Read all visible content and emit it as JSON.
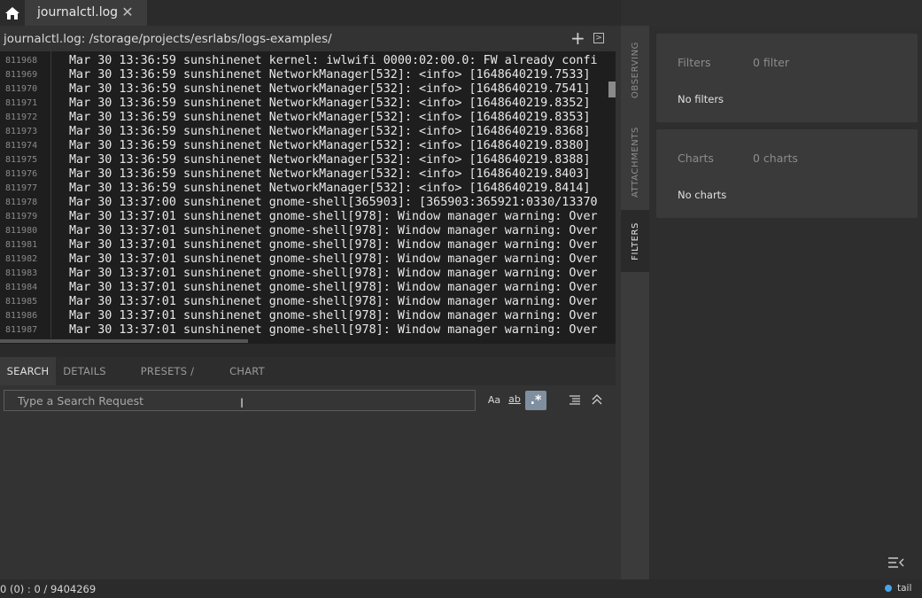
{
  "tabs": {
    "home_icon": "home-icon",
    "file_tab_label": "journalctl.log",
    "close_symbol": "✕"
  },
  "pathbar": {
    "label": "journalctl.log: /storage/projects/esrlabs/logs-examples/",
    "add_symbol": "+",
    "panel_symbol": ">"
  },
  "log": {
    "rows": [
      {
        "num": "811968",
        "text": "Mar 30 13:36:59 sunshinenet kernel: iwlwifi 0000:02:00.0: FW already confi"
      },
      {
        "num": "811969",
        "text": "Mar 30 13:36:59 sunshinenet NetworkManager[532]: <info> [1648640219.7533]"
      },
      {
        "num": "811970",
        "text": "Mar 30 13:36:59 sunshinenet NetworkManager[532]: <info> [1648640219.7541]"
      },
      {
        "num": "811971",
        "text": "Mar 30 13:36:59 sunshinenet NetworkManager[532]: <info> [1648640219.8352]"
      },
      {
        "num": "811972",
        "text": "Mar 30 13:36:59 sunshinenet NetworkManager[532]: <info> [1648640219.8353]"
      },
      {
        "num": "811973",
        "text": "Mar 30 13:36:59 sunshinenet NetworkManager[532]: <info> [1648640219.8368]"
      },
      {
        "num": "811974",
        "text": "Mar 30 13:36:59 sunshinenet NetworkManager[532]: <info> [1648640219.8380]"
      },
      {
        "num": "811975",
        "text": "Mar 30 13:36:59 sunshinenet NetworkManager[532]: <info> [1648640219.8388]"
      },
      {
        "num": "811976",
        "text": "Mar 30 13:36:59 sunshinenet NetworkManager[532]: <info> [1648640219.8403]"
      },
      {
        "num": "811977",
        "text": "Mar 30 13:36:59 sunshinenet NetworkManager[532]: <info> [1648640219.8414]"
      },
      {
        "num": "811978",
        "text": "Mar 30 13:37:00 sunshinenet gnome-shell[365903]: [365903:365921:0330/13370"
      },
      {
        "num": "811979",
        "text": "Mar 30 13:37:01 sunshinenet gnome-shell[978]: Window manager warning: Over"
      },
      {
        "num": "811980",
        "text": "Mar 30 13:37:01 sunshinenet gnome-shell[978]: Window manager warning: Over"
      },
      {
        "num": "811981",
        "text": "Mar 30 13:37:01 sunshinenet gnome-shell[978]: Window manager warning: Over"
      },
      {
        "num": "811982",
        "text": "Mar 30 13:37:01 sunshinenet gnome-shell[978]: Window manager warning: Over"
      },
      {
        "num": "811983",
        "text": "Mar 30 13:37:01 sunshinenet gnome-shell[978]: Window manager warning: Over"
      },
      {
        "num": "811984",
        "text": "Mar 30 13:37:01 sunshinenet gnome-shell[978]: Window manager warning: Over"
      },
      {
        "num": "811985",
        "text": "Mar 30 13:37:01 sunshinenet gnome-shell[978]: Window manager warning: Over"
      },
      {
        "num": "811986",
        "text": "Mar 30 13:37:01 sunshinenet gnome-shell[978]: Window manager warning: Over"
      },
      {
        "num": "811987",
        "text": "Mar 30 13:37:01 sunshinenet gnome-shell[978]: Window manager warning: Over"
      }
    ]
  },
  "bottom": {
    "tabs": [
      "SEARCH",
      "DETAILS",
      "PRESETS / HISTORY",
      "CHART"
    ],
    "active_tab": "SEARCH",
    "search_placeholder": "Type a Search Request",
    "search_value": "",
    "opt_case_label": "Aa",
    "opt_word_label": "ab",
    "opt_regex_label": ".*",
    "list_icon": "list-icon",
    "collapse_icon": "chevron-up-double-icon"
  },
  "sidetabs": [
    "OBSERVING",
    "ATTACHMENTS",
    "FILTERS"
  ],
  "sidetabs_active": "FILTERS",
  "right": {
    "filters_title": "Filters",
    "filters_count": "0 filter",
    "filters_empty": "No filters",
    "charts_title": "Charts",
    "charts_count": "0 charts",
    "charts_empty": "No charts",
    "menu_icon": "collapse-menu-icon"
  },
  "status": {
    "left": "0 (0) : 0 / 9404269",
    "tail_label": "tail",
    "tail_color": "#4aa3e6"
  },
  "colors": {
    "background": "#333333",
    "log_background": "#1e1e1e",
    "active_option": "#7f8f9f"
  }
}
